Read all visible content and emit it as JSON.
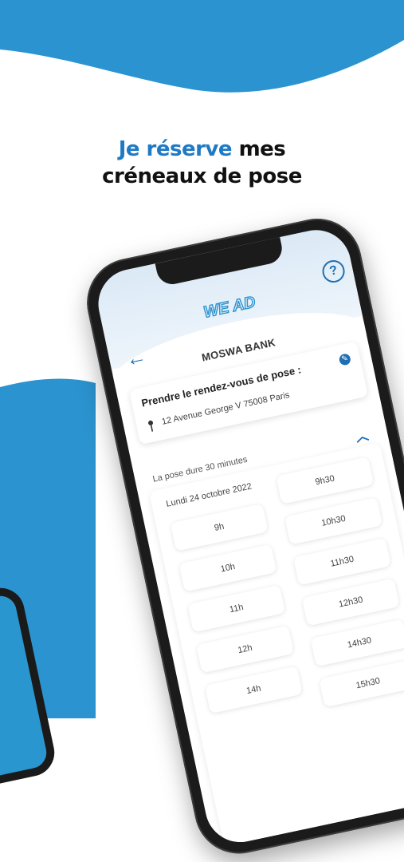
{
  "headline": {
    "accent": "Je réserve",
    "rest_line1": " mes",
    "line2": "créneaux de pose"
  },
  "app": {
    "logo_text": "WE AD",
    "help_label": "?",
    "back_label": "←",
    "company": "MOSWA BANK"
  },
  "appointment": {
    "title": "Prendre le rendez-vous de pose :",
    "address": "12 Avenue George V 75008 Paris",
    "duration": "La pose dure 30 minutes",
    "date": "Lundi 24 octobre 2022"
  },
  "slots": {
    "left": [
      "9h",
      "10h",
      "11h",
      "12h",
      "14h"
    ],
    "right": [
      "9h30",
      "10h30",
      "11h30",
      "12h30",
      "14h30",
      "15h30"
    ]
  },
  "colors": {
    "accent": "#1e7ac4",
    "wave": "#2b93cf"
  }
}
